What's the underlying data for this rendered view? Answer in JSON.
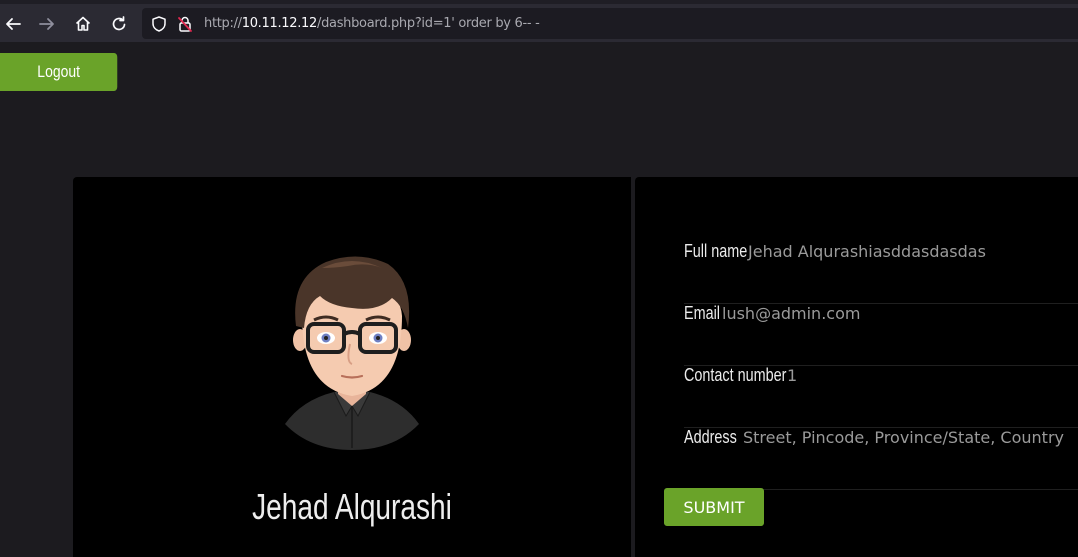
{
  "browser": {
    "url_prefix": "http://",
    "url_host": "10.11.12.12",
    "url_path": "/dashboard.php?id=1' order by 6-- -"
  },
  "page": {
    "logout_label": "Logout",
    "profile_name": "Jehad Alqurashi",
    "submit_label": "SUBMIT",
    "accent_color": "#6aa329"
  },
  "fields": {
    "full_name": {
      "label": "Full name",
      "value": "Jehad Alqurashiasddasdasdas"
    },
    "email": {
      "label": "Email",
      "value": "lush@admin.com"
    },
    "contact": {
      "label": "Contact number",
      "value": "1"
    },
    "address": {
      "label": "Address",
      "value": "Street, Pincode, Province/State, Country"
    }
  }
}
